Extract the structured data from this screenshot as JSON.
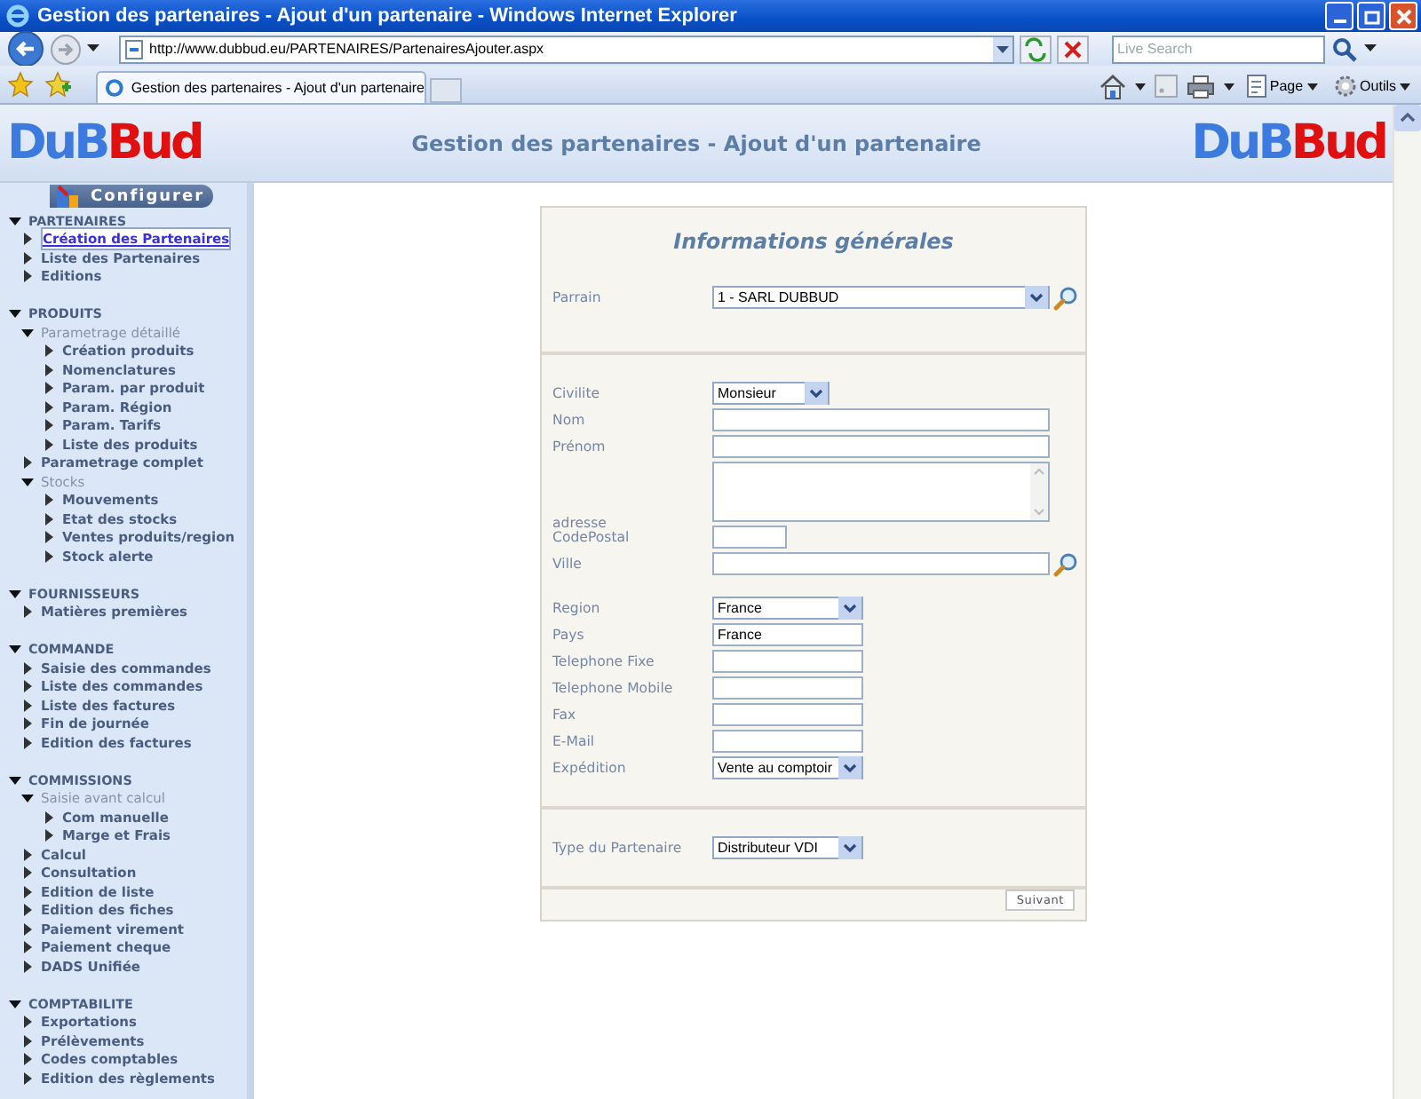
{
  "window": {
    "title": "Gestion des partenaires - Ajout d'un partenaire - Windows Internet Explorer"
  },
  "address_bar": {
    "url": "http://www.dubbud.eu/PARTENAIRES/PartenairesAjouter.aspx"
  },
  "search": {
    "placeholder": "Live Search"
  },
  "tabs": [
    {
      "label": "Gestion des partenaires - Ajout d'un partenaire",
      "selected": true
    }
  ],
  "toolbar": [
    {
      "label": "Page"
    },
    {
      "label": "Outils"
    }
  ],
  "header": {
    "title": "Gestion des partenaires - Ajout d'un partenaire",
    "logos": [
      {
        "first": "DuB",
        "second": "Bud"
      },
      {
        "first": "DuB",
        "second": "Bud"
      }
    ]
  },
  "sidebar": {
    "button": "Configurer",
    "sections": [
      {
        "label": "PARTENAIRES",
        "expanded": true,
        "items": [
          {
            "kind": "link",
            "label": "Création des Partenaires",
            "selected": true
          },
          {
            "kind": "link",
            "label": "Liste des Partenaires",
            "selected": false
          },
          {
            "kind": "link",
            "label": "Editions",
            "selected": false
          }
        ]
      },
      {
        "label": "PRODUITS",
        "expanded": true,
        "items": [
          {
            "kind": "group",
            "label": "Parametrage détaillé",
            "expanded": true,
            "children": [
              {
                "kind": "link",
                "label": "Création produits",
                "selected": false
              },
              {
                "kind": "link",
                "label": "Nomenclatures",
                "selected": false
              },
              {
                "kind": "link",
                "label": "Param. par produit",
                "selected": false
              },
              {
                "kind": "link",
                "label": "Param. Région",
                "selected": false
              },
              {
                "kind": "link",
                "label": "Param. Tarifs",
                "selected": false
              },
              {
                "kind": "link",
                "label": "Liste des produits",
                "selected": false
              }
            ]
          },
          {
            "kind": "link",
            "label": "Parametrage complet",
            "selected": false
          },
          {
            "kind": "group",
            "label": "Stocks",
            "expanded": true,
            "children": [
              {
                "kind": "link",
                "label": "Mouvements",
                "selected": false
              },
              {
                "kind": "link",
                "label": "Etat des stocks",
                "selected": false
              },
              {
                "kind": "link",
                "label": "Ventes produits/region",
                "selected": false
              },
              {
                "kind": "link",
                "label": "Stock alerte",
                "selected": false
              }
            ]
          }
        ]
      },
      {
        "label": "FOURNISSEURS",
        "expanded": true,
        "items": [
          {
            "kind": "link",
            "label": "Matières premières",
            "selected": false
          }
        ]
      },
      {
        "label": "COMMANDE",
        "expanded": true,
        "items": [
          {
            "kind": "link",
            "label": "Saisie des commandes",
            "selected": false
          },
          {
            "kind": "link",
            "label": "Liste des commandes",
            "selected": false
          },
          {
            "kind": "link",
            "label": "Liste des factures",
            "selected": false
          },
          {
            "kind": "link",
            "label": "Fin de journée",
            "selected": false
          },
          {
            "kind": "link",
            "label": "Edition des factures",
            "selected": false
          }
        ]
      },
      {
        "label": "COMMISSIONS",
        "expanded": true,
        "items": [
          {
            "kind": "group",
            "label": "Saisie avant calcul",
            "expanded": true,
            "children": [
              {
                "kind": "link",
                "label": "Com manuelle",
                "selected": false
              },
              {
                "kind": "link",
                "label": "Marge et Frais",
                "selected": false
              }
            ]
          },
          {
            "kind": "link",
            "label": "Calcul",
            "selected": false
          },
          {
            "kind": "link",
            "label": "Consultation",
            "selected": false
          },
          {
            "kind": "link",
            "label": "Edition de liste",
            "selected": false
          },
          {
            "kind": "link",
            "label": "Edition des fiches",
            "selected": false
          },
          {
            "kind": "link",
            "label": "Paiement virement",
            "selected": false
          },
          {
            "kind": "link",
            "label": "Paiement cheque",
            "selected": false
          },
          {
            "kind": "link",
            "label": "DADS Unifiée",
            "selected": false
          }
        ]
      },
      {
        "label": "COMPTABILITE",
        "expanded": true,
        "items": [
          {
            "kind": "link",
            "label": "Exportations",
            "selected": false
          },
          {
            "kind": "link",
            "label": "Prélèvements",
            "selected": false
          },
          {
            "kind": "link",
            "label": "Codes comptables",
            "selected": false
          },
          {
            "kind": "link",
            "label": "Edition des règlements",
            "selected": false
          }
        ]
      }
    ]
  },
  "form": {
    "title": "Informations générales",
    "submit": "Suivant",
    "groups": [
      [
        {
          "label": "Parrain",
          "kind": "select",
          "value": "1 - SARL DUBBUD",
          "lookup": true
        }
      ],
      [
        {
          "label": "Civilite",
          "kind": "select",
          "value": "Monsieur"
        },
        {
          "label": "Nom",
          "kind": "input"
        },
        {
          "label": "Prénom",
          "kind": "input"
        },
        {
          "label": "adresse",
          "kind": "textarea"
        },
        {
          "label": "CodePostal",
          "kind": "input"
        },
        {
          "label": "Ville",
          "kind": "input",
          "lookup": true
        },
        {
          "label": "Region",
          "kind": "select",
          "value": "France"
        },
        {
          "label": "Pays",
          "kind": "input",
          "value": "France"
        },
        {
          "label": "Telephone Fixe",
          "kind": "input"
        },
        {
          "label": "Telephone Mobile",
          "kind": "input"
        },
        {
          "label": "Fax",
          "kind": "input"
        },
        {
          "label": "E-Mail",
          "kind": "input"
        },
        {
          "label": "Expédition",
          "kind": "select",
          "value": "Vente au comptoir"
        }
      ],
      [
        {
          "label": "Type du Partenaire",
          "kind": "select",
          "value": "Distributeur VDI"
        }
      ]
    ]
  }
}
